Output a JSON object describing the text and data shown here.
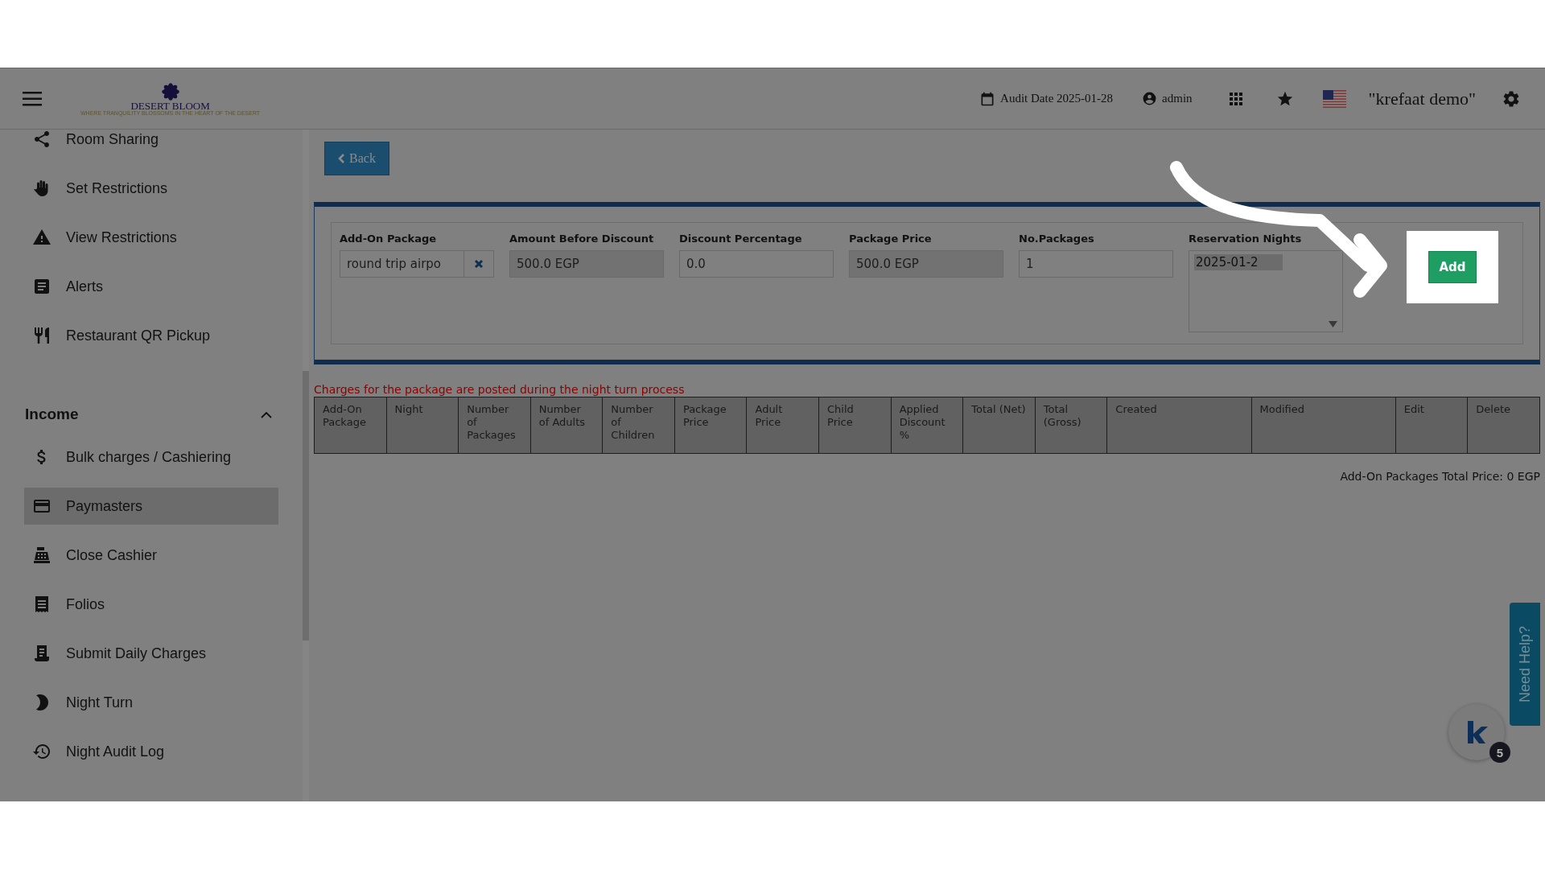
{
  "header": {
    "logo_name": "DESERT BLOOM",
    "logo_tagline": "WHERE TRANQUILITY BLOSSOMS IN THE HEART OF THE DESERT",
    "audit_date": "Audit Date 2025-01-28",
    "user": "admin",
    "company": "\"krefaat demo\""
  },
  "sidebar": {
    "sections": [
      {
        "items": [
          {
            "label": "Room Sharing",
            "selected": false
          },
          {
            "label": "Set Restrictions",
            "selected": false
          },
          {
            "label": "View Restrictions",
            "selected": false
          },
          {
            "label": "Alerts",
            "selected": false
          },
          {
            "label": "Restaurant QR Pickup",
            "selected": false
          }
        ]
      },
      {
        "title": "Income",
        "expanded": true,
        "items": [
          {
            "label": "Bulk charges / Cashiering",
            "selected": false
          },
          {
            "label": "Paymasters",
            "selected": true
          },
          {
            "label": "Close Cashier",
            "selected": false
          },
          {
            "label": "Folios",
            "selected": false
          },
          {
            "label": "Submit Daily Charges",
            "selected": false
          },
          {
            "label": "Night Turn",
            "selected": false
          },
          {
            "label": "Night Audit Log",
            "selected": false
          }
        ]
      }
    ]
  },
  "back_button": "Back",
  "form": {
    "fields": [
      {
        "label": "Add-On Package",
        "value": "round trip airpo",
        "kind": "clearable"
      },
      {
        "label": "Amount Before Discount",
        "value": "500.0 EGP",
        "kind": "readonly"
      },
      {
        "label": "Discount Percentage",
        "value": "0.0",
        "kind": "input"
      },
      {
        "label": "Package Price",
        "value": "500.0 EGP",
        "kind": "readonly"
      },
      {
        "label": "No.Packages",
        "value": "1",
        "kind": "input"
      },
      {
        "label": "Reservation Nights",
        "value": "2025-01-2",
        "kind": "multiselect"
      }
    ],
    "add_button": "Add"
  },
  "note": "Charges for the package are posted during the night turn process",
  "table": {
    "columns": [
      "Add-On Package",
      "Night",
      "Number of Packages",
      "Number of Adults",
      "Number of Children",
      "Package Price",
      "Adult Price",
      "Child Price",
      "Applied Discount %",
      "Total (Net)",
      "Total (Gross)",
      "Created",
      "Modified",
      "Edit",
      "Delete"
    ]
  },
  "total": "Add-On Packages Total Price: 0 EGP",
  "help_tab": "Need Help?",
  "chat_badge": "5"
}
